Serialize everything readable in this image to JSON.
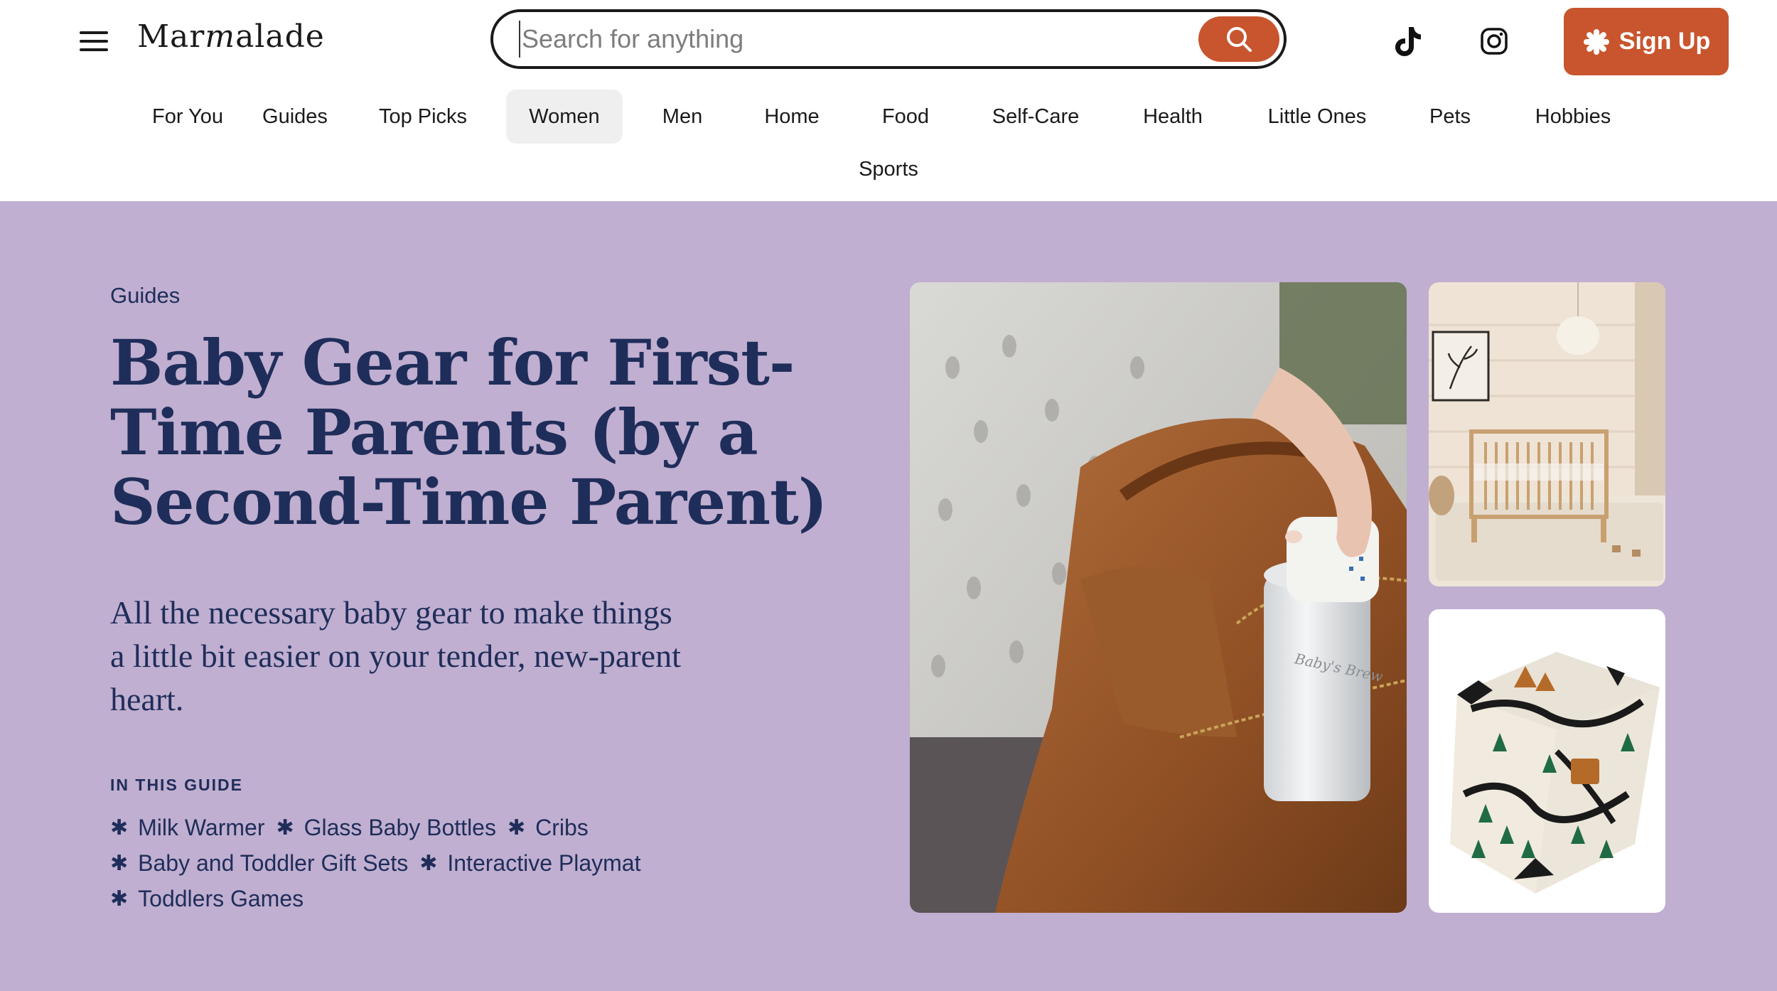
{
  "header": {
    "logo_text": "Marmalade",
    "search_placeholder": "Search for anything",
    "signup_label": "Sign Up",
    "social": [
      "tiktok-icon",
      "instagram-icon"
    ]
  },
  "nav": {
    "items": [
      "For You",
      "Guides",
      "Top Picks",
      "Women",
      "Men",
      "Home",
      "Food",
      "Self-Care",
      "Health",
      "Little Ones",
      "Pets",
      "Hobbies",
      "Sports"
    ],
    "active": "Women"
  },
  "hero": {
    "eyebrow": "Guides",
    "title": "Baby Gear for First-Time Parents (by a Second-Time Parent)",
    "subtitle": "All the necessary baby gear to make things a little bit easier on your tender, new-parent heart.",
    "guide_heading": "IN THIS GUIDE",
    "guide_items": [
      "Milk Warmer",
      "Glass Baby Bottles",
      "Cribs",
      "Baby and Toddler Gift Sets",
      "Interactive Playmat",
      "Toddlers Games"
    ],
    "images": [
      {
        "name": "diaper-bag-with-milk-warmer-photo",
        "brand_text": "Baby's Brew"
      },
      {
        "name": "nursery-crib-photo"
      },
      {
        "name": "printed-cube-playmat-photo"
      }
    ]
  },
  "colors": {
    "accent": "#c8552d",
    "hero_bg": "#c0afd0",
    "navy": "#1f2d5a",
    "active_nav_bg": "#efefef"
  }
}
